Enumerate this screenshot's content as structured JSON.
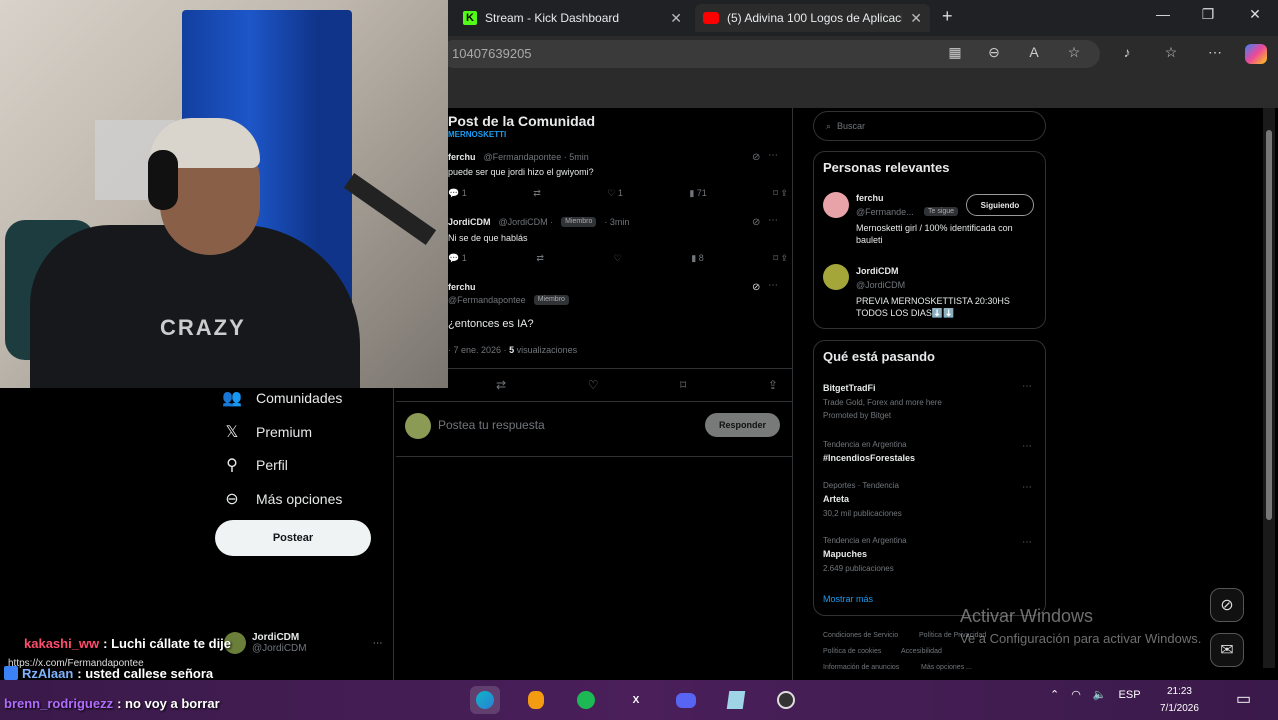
{
  "browser": {
    "tabs": [
      {
        "label": "Stream - Kick Dashboard"
      },
      {
        "label": "(5) Adivina 100 Logos de Aplicaci"
      }
    ],
    "address": "10407639205"
  },
  "nav": {
    "communities": "Comunidades",
    "premium": "Premium",
    "profile": "Perfil",
    "more": "Más opciones",
    "post_button": "Postear",
    "account_name": "JordiCDM",
    "account_handle": "@JordiCDM"
  },
  "thread": {
    "title": "Post de la Comunidad",
    "subtitle": "MERNOSKETTI",
    "tweets": [
      {
        "name": "ferchu",
        "handle": "@Fermandapontee · 5min",
        "text": "puede ser que jordi hizo el gwiyomi?",
        "replies": "1",
        "likes": "1",
        "views": "71"
      },
      {
        "name": "JordiCDM",
        "handle": "@JordiCDM ·",
        "badge": "Miembro",
        "time": "· 3min",
        "text": "Ni se de que hablás",
        "replies": "1",
        "views": "8"
      },
      {
        "name": "ferchu",
        "handle": "@Fermandapontee",
        "badge": "Miembro"
      }
    ],
    "main_text": "¿entonces es IA?",
    "meta_time": "· 7 ene. 2026 ·",
    "meta_views": "5",
    "meta_views_label": "visualizaciones",
    "reply_placeholder": "Postea tu respuesta",
    "reply_button": "Responder"
  },
  "sidebar": {
    "search_placeholder": "Buscar",
    "relevant_title": "Personas relevantes",
    "people": [
      {
        "name": "ferchu",
        "handle": "@Fermande...",
        "tag": "Te sigue",
        "bio": "Mernosketti girl / 100% identificada con bauleti",
        "button": "Siguiendo"
      },
      {
        "name": "JordiCDM",
        "handle": "@JordiCDM",
        "bio": "PREVIA MERNOSKETTISTA 20:30HS TODOS LOS DIAS⬇️⬇️"
      }
    ],
    "trending_title": "Qué está pasando",
    "trends": [
      {
        "name": "BitgetTradFi",
        "line1": "Trade Gold, Forex and more here",
        "line2": "Promoted by Bitget"
      },
      {
        "top": "Tendencia en Argentina",
        "name": "#IncendiosForestales"
      },
      {
        "top": "Deportes · Tendencia",
        "name": "Arteta",
        "count": "30,2 mil publicaciones"
      },
      {
        "top": "Tendencia en Argentina",
        "name": "Mapuches",
        "count": "2.649 publicaciones"
      }
    ],
    "show_more": "Mostrar más",
    "footer": {
      "terms": "Condiciones de Servicio",
      "privacy": "Política de Privacidad",
      "cookies": "Política de cookies",
      "accessibility": "Accesibilidad",
      "ads": "Información de anuncios",
      "more": "Más opciones ..."
    }
  },
  "watermark": {
    "line1": "Activar Windows",
    "line2": "Ve a Configuración para activar Windows."
  },
  "chat": [
    {
      "user": "kakashi_ww",
      "msg": ": Luchi cállate te dije",
      "color": "#ff4d6d"
    },
    {
      "user": "RzAlaan",
      "msg": ": usted callese señora",
      "color": "#7fb3ff"
    },
    {
      "user": "brenn_rodriguezz",
      "msg": ": no voy a borrar",
      "color": "#b16cff"
    }
  ],
  "chat_link": "https://x.com/Fermandapontee",
  "taskbar": {
    "lang": "ESP",
    "time": "21:23",
    "date": "7/1/2026"
  },
  "webcam": {
    "shirt_text": "CRAZY"
  }
}
